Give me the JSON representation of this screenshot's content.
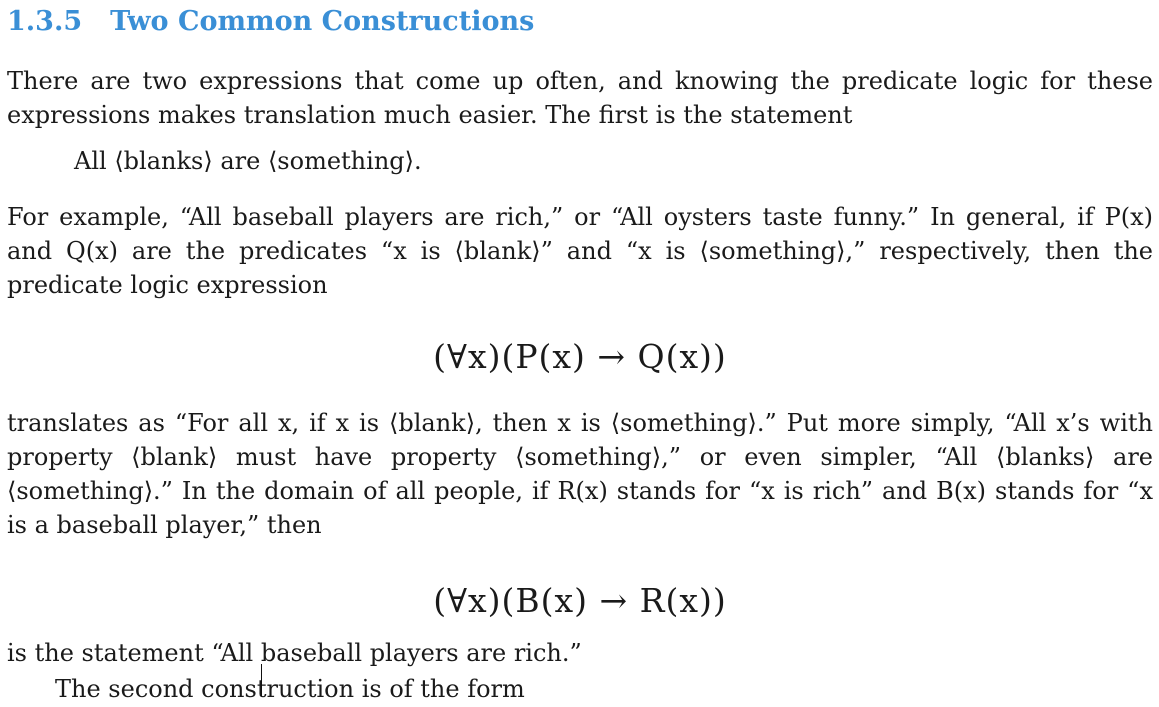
{
  "heading": {
    "number": "1.3.5",
    "title": "Two Common Constructions"
  },
  "paragraphs": {
    "p1": "There are two expressions that come up often, and knowing the predicate logic for these expressions makes translation much easier. The first is the statement",
    "indented_statement": "All ⟨blanks⟩ are ⟨something⟩.",
    "p2": "For example, “All baseball players are rich,” or “All oysters taste funny.” In general, if P(x) and Q(x) are the predicates “x is ⟨blank⟩” and “x is ⟨something⟩,” respectively, then the predicate logic expression",
    "display1": "(∀x)(P(x) → Q(x))",
    "p3": "translates as “For all x, if x is ⟨blank⟩, then x is ⟨something⟩.” Put more simply, “All x’s with property ⟨blank⟩ must have property ⟨something⟩,” or even simpler, “All ⟨blanks⟩ are ⟨something⟩.” In the domain of all people, if R(x) stands for “x is rich” and B(x) stands for “x is a baseball player,” then",
    "display2": "(∀x)(B(x) → R(x))",
    "p4": "is the statement “All baseball players are rich.”",
    "p5": "The second construction is of the form"
  }
}
